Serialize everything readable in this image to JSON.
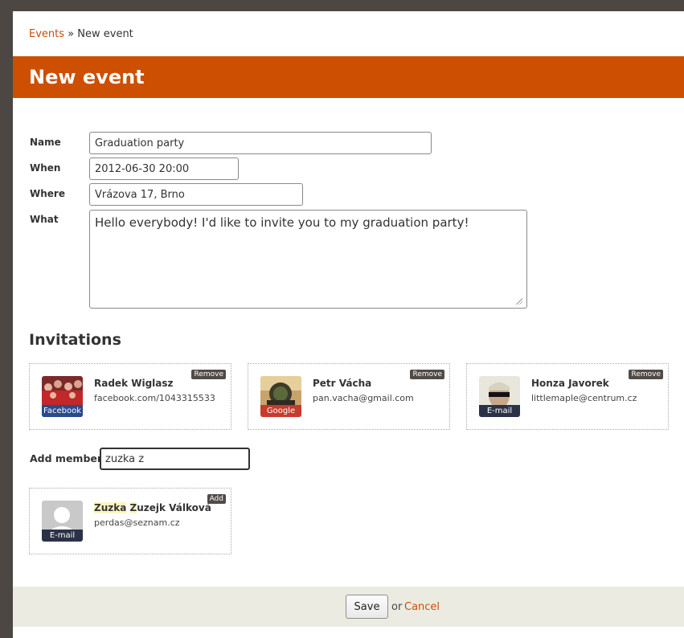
{
  "breadcrumb": {
    "link": "Events",
    "separator": "»",
    "current": "New event"
  },
  "page": {
    "title": "New event"
  },
  "form": {
    "name_label": "Name",
    "name_value": "Graduation party",
    "when_label": "When",
    "when_value": "2012-06-30 20:00",
    "where_label": "Where",
    "where_value": "Vrázova 17, Brno",
    "what_label": "What",
    "what_value": "Hello everybody! I'd like to invite you to my graduation party!"
  },
  "invitations": {
    "title": "Invitations",
    "remove_label": "Remove",
    "cards": [
      {
        "name": "Radek Wiglasz",
        "contact": "facebook.com/1043315533",
        "source": "Facebook",
        "source_color": "#2a4a8b"
      },
      {
        "name": "Petr Vácha",
        "contact": "pan.vacha@gmail.com",
        "source": "Google",
        "source_color": "#c63b2b"
      },
      {
        "name": "Honza Javorek",
        "contact": "littlemaple@centrum.cz",
        "source": "E-mail",
        "source_color": "#2b3146"
      }
    ]
  },
  "add_member": {
    "label": "Add member",
    "input_value": "zuzka z",
    "add_label": "Add",
    "result": {
      "name_match_1": "Zuzka",
      "name_sep": " ",
      "name_match_2": "Z",
      "name_rest": "uzejk Válková",
      "contact": "perdas@seznam.cz",
      "source": "E-mail",
      "source_color": "#2b3146"
    }
  },
  "footer": {
    "save_label": "Save",
    "or_text": "or",
    "cancel_label": "Cancel"
  },
  "colors": {
    "accent": "#cd4f02",
    "link": "#c94e0c",
    "footer_bg": "#ecebe2",
    "outer_bg": "#4d4744"
  }
}
